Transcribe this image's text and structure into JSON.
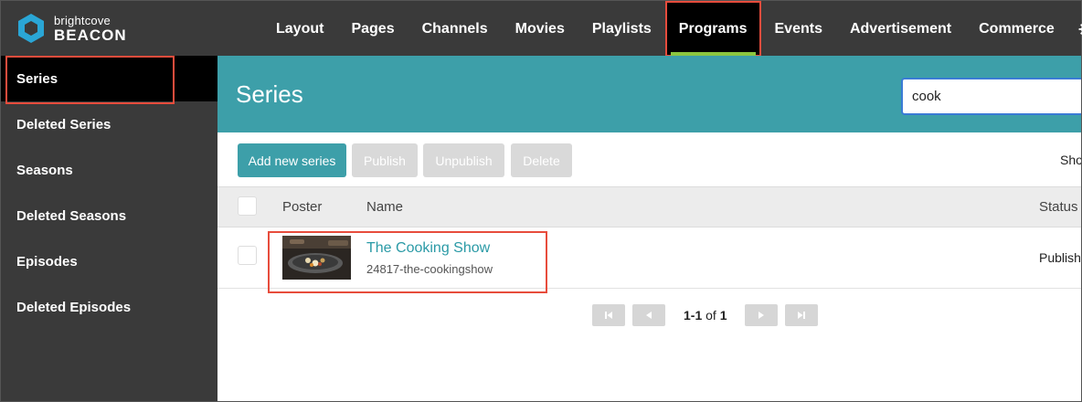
{
  "logo": {
    "small": "brightcove",
    "big": "BEACON"
  },
  "nav": {
    "items": [
      {
        "label": "Layout"
      },
      {
        "label": "Pages"
      },
      {
        "label": "Channels"
      },
      {
        "label": "Movies"
      },
      {
        "label": "Playlists"
      },
      {
        "label": "Programs"
      },
      {
        "label": "Events"
      },
      {
        "label": "Advertisement"
      },
      {
        "label": "Commerce"
      }
    ],
    "settings_icon": "gear-icon",
    "tools_icon": "wrench-icon"
  },
  "sidebar": {
    "items": [
      {
        "label": "Series"
      },
      {
        "label": "Deleted Series"
      },
      {
        "label": "Seasons"
      },
      {
        "label": "Deleted Seasons"
      },
      {
        "label": "Episodes"
      },
      {
        "label": "Deleted Episodes"
      }
    ]
  },
  "main": {
    "title": "Series",
    "search_value": "cook",
    "toolbar": {
      "add": "Add new series",
      "publish": "Publish",
      "unpublish": "Unpublish",
      "delete": "Delete",
      "show": "Sho"
    },
    "columns": {
      "poster": "Poster",
      "name": "Name",
      "status": "Status"
    },
    "rows": [
      {
        "name": "The Cooking Show",
        "slug": "24817-the-cookingshow",
        "status": "Publish"
      }
    ],
    "pagination": {
      "range": "1-1",
      "of": "of",
      "total": "1"
    }
  },
  "colors": {
    "accent": "#3d9fa9",
    "highlight": "#e74c3c",
    "active_bar": "#8cc63f",
    "nav_bg": "#3a3a3a"
  }
}
